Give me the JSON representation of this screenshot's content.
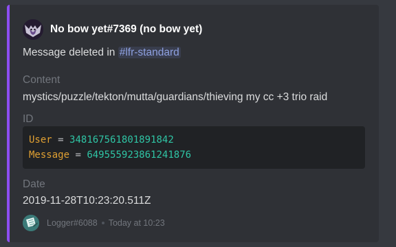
{
  "embed": {
    "accent_color": "#8d4ef3",
    "author": {
      "name": "No bow yet#7369 (no bow yet)",
      "avatar_icon": "bat-avatar-icon"
    },
    "description": {
      "prefix": "Message deleted in ",
      "channel_mention": "#lfr-standard"
    },
    "fields": {
      "content": {
        "name": "Content",
        "value": "mystics/puzzle/tekton/mutta/guardians/thieving my cc +3 trio raid"
      },
      "id": {
        "name": "ID",
        "user_key": "User",
        "user_value": "348167561801891842",
        "message_key": "Message",
        "message_value": "649555923861241876",
        "operator": "="
      },
      "date": {
        "name": "Date",
        "value": "2019-11-28T10:23:20.511Z"
      }
    },
    "footer": {
      "text": "Logger#6088",
      "timestamp": "Today at 10:23",
      "icon": "notepad-icon"
    }
  }
}
